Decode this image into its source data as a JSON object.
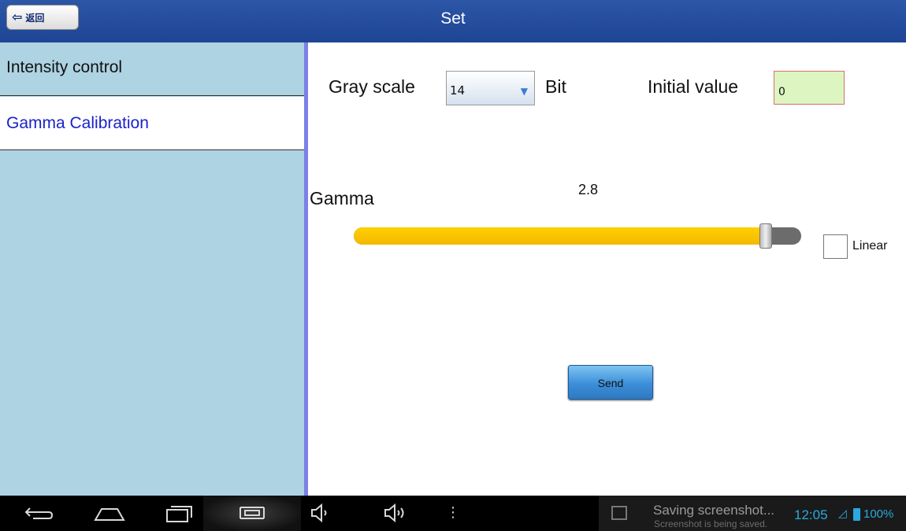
{
  "header": {
    "back_label": "返回",
    "title": "Set"
  },
  "sidebar": {
    "items": [
      {
        "label": "Intensity control",
        "selected": false
      },
      {
        "label": "Gamma Calibration",
        "selected": true
      }
    ]
  },
  "main": {
    "gray_scale_label": "Gray scale",
    "gray_scale_value": "14",
    "bit_label": "Bit",
    "initial_value_label": "Initial value",
    "initial_value": "0",
    "gamma_label": "Gamma",
    "gamma_value": "2.8",
    "gamma_slider_level": 0.92,
    "linear_label": "Linear",
    "linear_checked": false,
    "send_label": "Send"
  },
  "navbar": {
    "icons": [
      "back-icon",
      "home-icon",
      "recent-apps-icon",
      "screenshot-icon",
      "volume-down-icon",
      "volume-up-icon",
      "menu-icon"
    ],
    "notification_title": "Saving screenshot...",
    "notification_sub": "Screenshot is being saved.",
    "clock": "12:05",
    "battery": "100%"
  },
  "colors": {
    "title_bar": "#2451a3",
    "sidebar_bg": "#aed3e3",
    "selected_text": "#1a22c9",
    "slider_fill": "#f5bd00",
    "divider": "#7b81e6",
    "status_accent": "#2aa9e0"
  }
}
